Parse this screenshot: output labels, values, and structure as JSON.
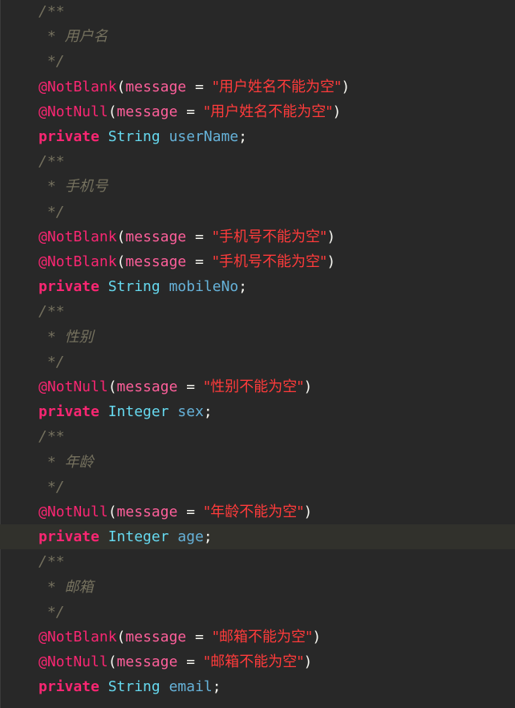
{
  "editor": {
    "current_line_index": 21,
    "colors": {
      "background": "#282828",
      "comment": "#75715e",
      "annotation": "#f92672",
      "keyword": "#f92672",
      "type": "#66d9ef",
      "identifier": "#66b2d9",
      "string": "#ff3b3b",
      "punctuation": "#f8f8f2"
    },
    "lines": [
      {
        "kind": "comment_open",
        "text": "/**"
      },
      {
        "kind": "comment_body",
        "prefix": " * ",
        "text": "用户名"
      },
      {
        "kind": "comment_close",
        "text": " */"
      },
      {
        "kind": "annotation",
        "name": "@NotBlank",
        "param": "message",
        "op": " = ",
        "value": "用户姓名不能为空"
      },
      {
        "kind": "annotation",
        "name": "@NotNull",
        "param": "message",
        "op": " = ",
        "value": "用户姓名不能为空"
      },
      {
        "kind": "field",
        "modifier": "private",
        "type": "String",
        "name": "userName"
      },
      {
        "kind": "comment_open",
        "text": "/**"
      },
      {
        "kind": "comment_body",
        "prefix": " * ",
        "text": "手机号"
      },
      {
        "kind": "comment_close",
        "text": " */"
      },
      {
        "kind": "annotation",
        "name": "@NotBlank",
        "param": "message",
        "op": " = ",
        "value": "手机号不能为空"
      },
      {
        "kind": "annotation",
        "name": "@NotBlank",
        "param": "message",
        "op": " = ",
        "value": "手机号不能为空"
      },
      {
        "kind": "field",
        "modifier": "private",
        "type": "String",
        "name": "mobileNo"
      },
      {
        "kind": "comment_open",
        "text": "/**"
      },
      {
        "kind": "comment_body",
        "prefix": " * ",
        "text": "性别"
      },
      {
        "kind": "comment_close",
        "text": " */"
      },
      {
        "kind": "annotation",
        "name": "@NotNull",
        "param": "message",
        "op": " = ",
        "value": "性别不能为空"
      },
      {
        "kind": "field",
        "modifier": "private",
        "type": "Integer",
        "name": "sex"
      },
      {
        "kind": "comment_open",
        "text": "/**"
      },
      {
        "kind": "comment_body",
        "prefix": " * ",
        "text": "年龄"
      },
      {
        "kind": "comment_close",
        "text": " */"
      },
      {
        "kind": "annotation",
        "name": "@NotNull",
        "param": "message",
        "op": " = ",
        "value": "年龄不能为空"
      },
      {
        "kind": "field",
        "modifier": "private",
        "type": "Integer",
        "name": "age"
      },
      {
        "kind": "comment_open",
        "text": "/**"
      },
      {
        "kind": "comment_body",
        "prefix": " * ",
        "text": "邮箱"
      },
      {
        "kind": "comment_close",
        "text": " */"
      },
      {
        "kind": "annotation",
        "name": "@NotBlank",
        "param": "message",
        "op": " = ",
        "value": "邮箱不能为空"
      },
      {
        "kind": "annotation",
        "name": "@NotNull",
        "param": "message",
        "op": " = ",
        "value": "邮箱不能为空"
      },
      {
        "kind": "field",
        "modifier": "private",
        "type": "String",
        "name": "email"
      }
    ]
  }
}
